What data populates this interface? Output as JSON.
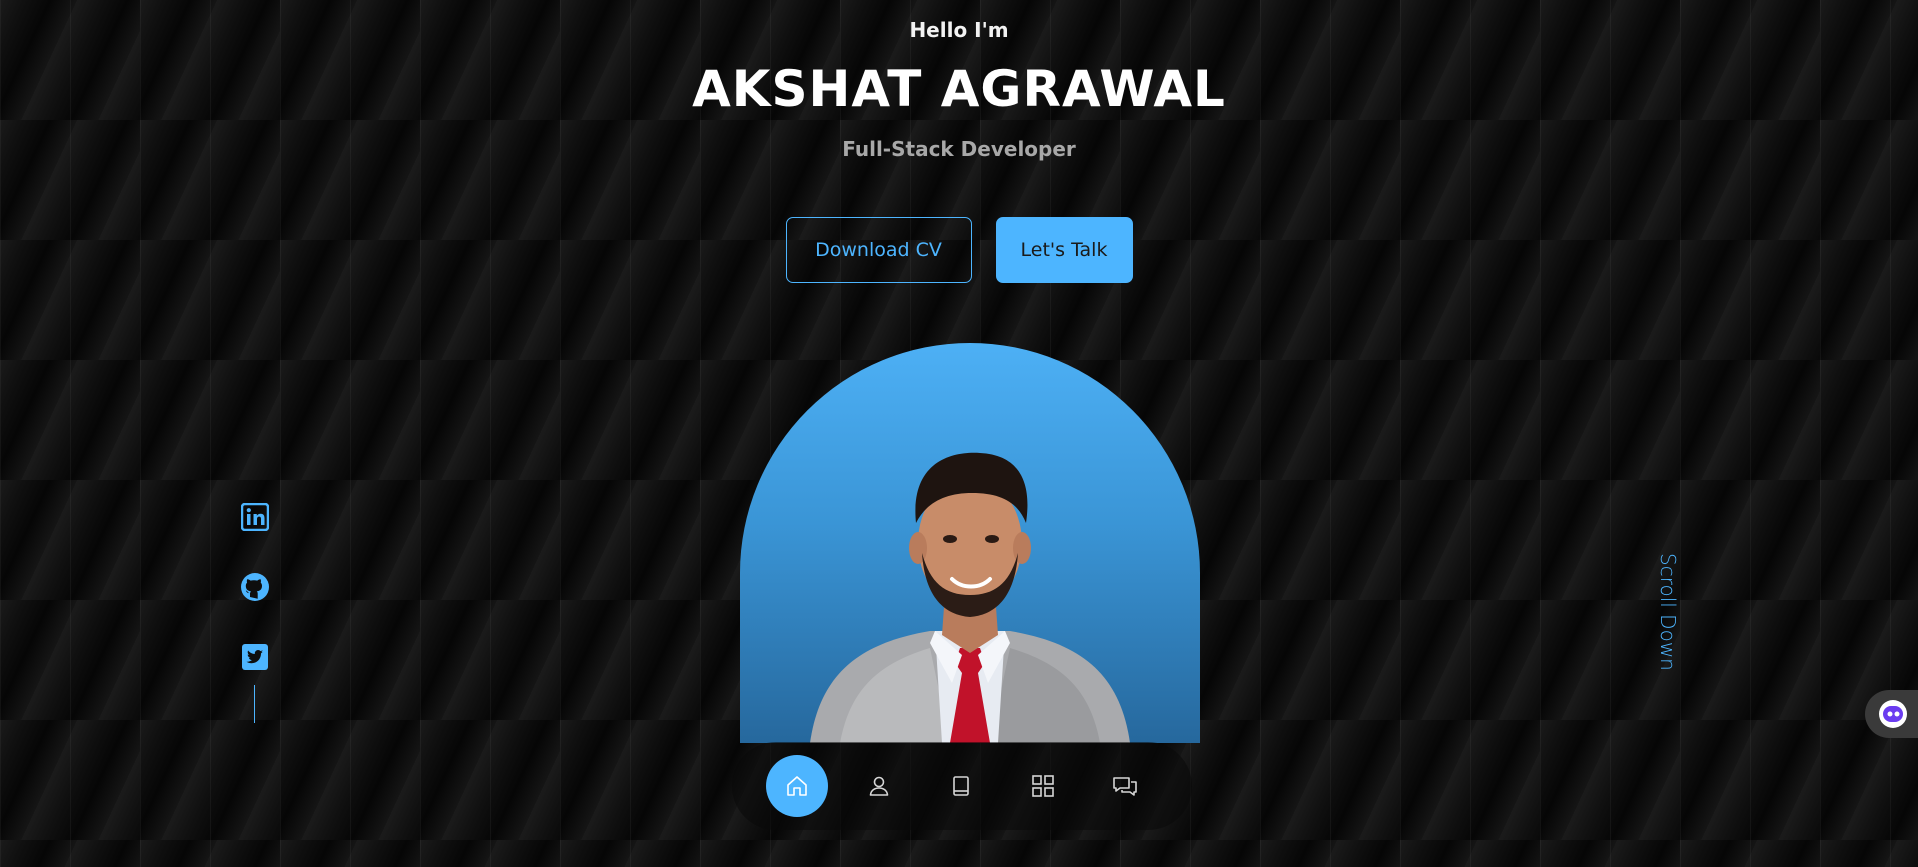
{
  "hero": {
    "greeting": "Hello I'm",
    "name": "AKSHAT AGRAWAL",
    "role": "Full-Stack Developer"
  },
  "cta": {
    "download_label": "Download CV",
    "talk_label": "Let's Talk"
  },
  "socials": [
    {
      "icon": "linkedin-icon"
    },
    {
      "icon": "github-icon"
    },
    {
      "icon": "twitter-icon"
    }
  ],
  "scroll_label": "Scroll Down",
  "nav": [
    {
      "icon": "home-icon",
      "active": true
    },
    {
      "icon": "user-icon",
      "active": false
    },
    {
      "icon": "book-icon",
      "active": false
    },
    {
      "icon": "grid-icon",
      "active": false
    },
    {
      "icon": "chat-icon",
      "active": false
    }
  ],
  "colors": {
    "accent": "#4db5ff",
    "background": "#0e0e0e",
    "text": "#ffffff",
    "muted": "#a8a8a8"
  }
}
